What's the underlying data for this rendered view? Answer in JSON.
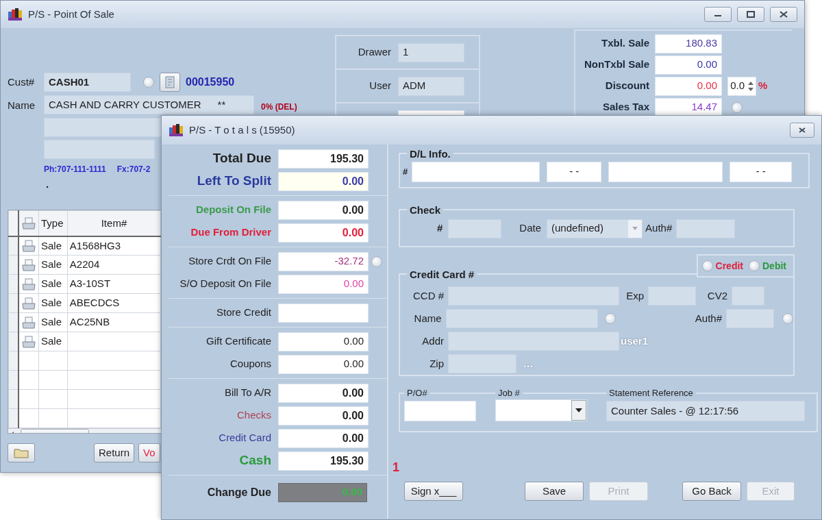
{
  "main_window": {
    "title": "P/S - Point Of Sale",
    "customer": {
      "cust_label": "Cust#",
      "cust_value": "CASH01",
      "radio": {
        "checked": false
      },
      "invoice": "00015950",
      "name_label": "Name",
      "name_value": "CASH AND CARRY CUSTOMER",
      "name_flag": "**",
      "tax_note": "0% (DEL)",
      "phone": "Ph:707-111-1111",
      "fax": "Fx:707-2",
      "note": "."
    },
    "session": [
      {
        "label": "Drawer",
        "value": "1"
      },
      {
        "label": "User",
        "value": "ADM"
      }
    ],
    "summary": [
      {
        "label": "Txbl. Sale",
        "value": "180.83",
        "color": "#4a3aa0"
      },
      {
        "label": "NonTxbl Sale",
        "value": "0.00",
        "color": "#3434a8"
      },
      {
        "label": "Discount",
        "value": "0.00",
        "color": "#e8303f"
      },
      {
        "label": "Sales Tax",
        "value": "14.47",
        "color": "#8a3ad0",
        "radio": {
          "checked": false
        }
      }
    ],
    "discount_rate": {
      "value": "0.0",
      "unit": "%"
    },
    "lines": {
      "columns": [
        "Type",
        "Item#"
      ],
      "rows": [
        {
          "type": "Sale",
          "item": "A1568HG3"
        },
        {
          "type": "Sale",
          "item": "A2204"
        },
        {
          "type": "Sale",
          "item": "A3-10ST"
        },
        {
          "type": "Sale",
          "item": "ABECDCS"
        },
        {
          "type": "Sale",
          "item": "AC25NB"
        },
        {
          "type": "Sale"
        }
      ]
    },
    "buttons": [
      {
        "label": "Return",
        "color": "#222222"
      },
      {
        "label": "Vo",
        "color": "#e0203a"
      }
    ]
  },
  "totals_dialog": {
    "title": "P/S - T o t a l s (15950)",
    "sections": [
      {
        "rows": [
          {
            "kind": "large",
            "label": "Total  Due",
            "value": "195.30"
          },
          {
            "kind": "large",
            "label": "Left To Split",
            "value": "0.00",
            "color": "#2a3aa0",
            "amount_tint": {
              "color": "#3a3aa8"
            }
          }
        ]
      },
      {
        "rows": [
          {
            "kind": "bold",
            "label": "Deposit On File",
            "value": "0.00",
            "color": "#3a9a4a"
          },
          {
            "kind": "bold",
            "label": "Due From Driver",
            "value": "0.00",
            "color": "#e0203a",
            "amount_tint": {
              "color": "#e0203a"
            }
          }
        ]
      },
      {
        "rows": [
          {
            "kind": "plain",
            "label": "Store Crdt On File",
            "value": "-32.72",
            "amount_tint": {
              "color": "#a0307a"
            },
            "radio": {
              "checked": false
            }
          },
          {
            "kind": "plain",
            "label": "S/O Deposit On File",
            "value": "0.00",
            "amount_tint": {
              "color": "#e040a0"
            }
          }
        ]
      },
      {
        "rows": [
          {
            "kind": "plain",
            "label": "Store Credit"
          }
        ]
      },
      {
        "rows": [
          {
            "kind": "plain",
            "label": "Gift Certificate",
            "value": "0.00"
          },
          {
            "kind": "plain",
            "label": "Coupons",
            "value": "0.00"
          }
        ]
      },
      {
        "rows": [
          {
            "kind": "total",
            "label": "Bill To A/R",
            "value": "0.00"
          },
          {
            "kind": "total",
            "label": "Checks",
            "value": "0.00",
            "color": "#b04050"
          },
          {
            "kind": "total",
            "label": "Credit Card",
            "value": "0.00",
            "color": "#3a3a9a"
          },
          {
            "kind": "large",
            "label": "Cash",
            "value": "195.30",
            "color": "#2a9a3a"
          }
        ]
      }
    ],
    "change_due": {
      "label": "Change Due",
      "value": "0.00"
    },
    "marker": "1",
    "dl_info": {
      "legend": "D/L Info.",
      "hash": "#",
      "fields": [
        {
          "kind": "number"
        },
        {
          "kind": "date",
          "value": "- -"
        },
        {
          "kind": "number"
        },
        {
          "kind": "date",
          "value": "- -"
        }
      ]
    },
    "check": {
      "legend": "Check",
      "number_label": "#",
      "date_label": "Date",
      "date_value": "(undefined)",
      "auth_label": "Auth#"
    },
    "card_type": [
      {
        "label": "Credit",
        "color": "#e0203a",
        "selected": false
      },
      {
        "label": "Debit",
        "color": "#2a9a3a",
        "selected": false
      }
    ],
    "credit_card": {
      "legend": "Credit Card #",
      "ccd_label": "CCD #",
      "exp_label": "Exp",
      "cv2_label": "CV2",
      "name_label": "Name",
      "name_radio": {
        "checked": false
      },
      "auth_label": "Auth#",
      "auth_radio": {
        "checked": false
      },
      "addr_label": "Addr",
      "addr_note": "user1",
      "zip_label": "Zip",
      "zip_note": "..."
    },
    "reference": {
      "po_label": "P/O#",
      "job_label": "Job #",
      "statement_label": "Statement Reference",
      "statement_value": "Counter Sales - @ 12:17:56"
    },
    "button_groups": [
      {
        "buttons": [
          {
            "label": "Sign x___",
            "disabled": false
          }
        ]
      },
      {
        "buttons": [
          {
            "label": "Save",
            "disabled": false
          },
          {
            "label": "Print",
            "disabled": true
          }
        ]
      },
      {
        "buttons": [
          {
            "label": "Go Back",
            "disabled": false
          },
          {
            "label": "Exit",
            "disabled": true
          }
        ]
      }
    ]
  }
}
